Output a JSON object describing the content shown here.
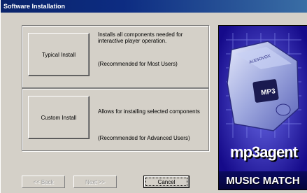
{
  "window": {
    "title": "Software Installation"
  },
  "typical": {
    "button_label": "Typical Install",
    "description": "Installs all components needed for interactive player operation.",
    "recommendation": "(Recommended for Most Users)"
  },
  "custom": {
    "button_label": "Custom Install",
    "description": "Allows for installing selected components",
    "recommendation": "(Recommended for Advanced Users)"
  },
  "nav": {
    "back_label": "<< Back",
    "next_label": "Next >>",
    "cancel_label": "Cancel"
  },
  "promo": {
    "product_name": "mp3agent",
    "device_brand": "AUDIOVOX",
    "device_label": "MP3",
    "company": "MUSIC MATCH",
    "colors": {
      "background": "#150a8a",
      "device": "#aab4e8"
    }
  }
}
